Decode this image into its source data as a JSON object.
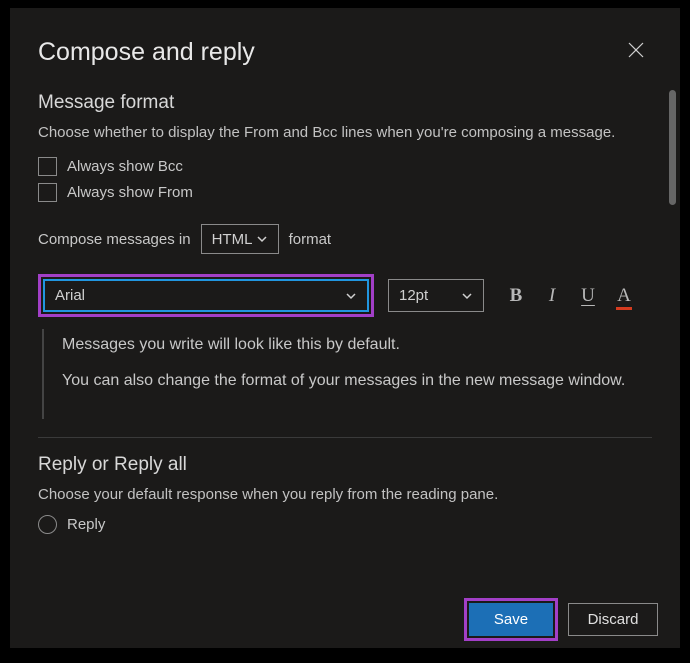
{
  "header": {
    "title": "Compose and reply"
  },
  "messageFormat": {
    "title": "Message format",
    "description": "Choose whether to display the From and Bcc lines when you're composing a message.",
    "bccLabel": "Always show Bcc",
    "fromLabel": "Always show From",
    "composePrefix": "Compose messages in",
    "composeFormatValue": "HTML",
    "composeSuffix": "format",
    "fontValue": "Arial",
    "fontSizeValue": "12pt",
    "boldGlyph": "B",
    "italicGlyph": "I",
    "underlineGlyph": "U",
    "colorGlyph": "A",
    "previewLine1": "Messages you write will look like this by default.",
    "previewLine2": "You can also change the format of your messages in the new message window."
  },
  "replySection": {
    "title": "Reply or Reply all",
    "description": "Choose your default response when you reply from the reading pane.",
    "option1": "Reply"
  },
  "footer": {
    "saveLabel": "Save",
    "discardLabel": "Discard"
  }
}
